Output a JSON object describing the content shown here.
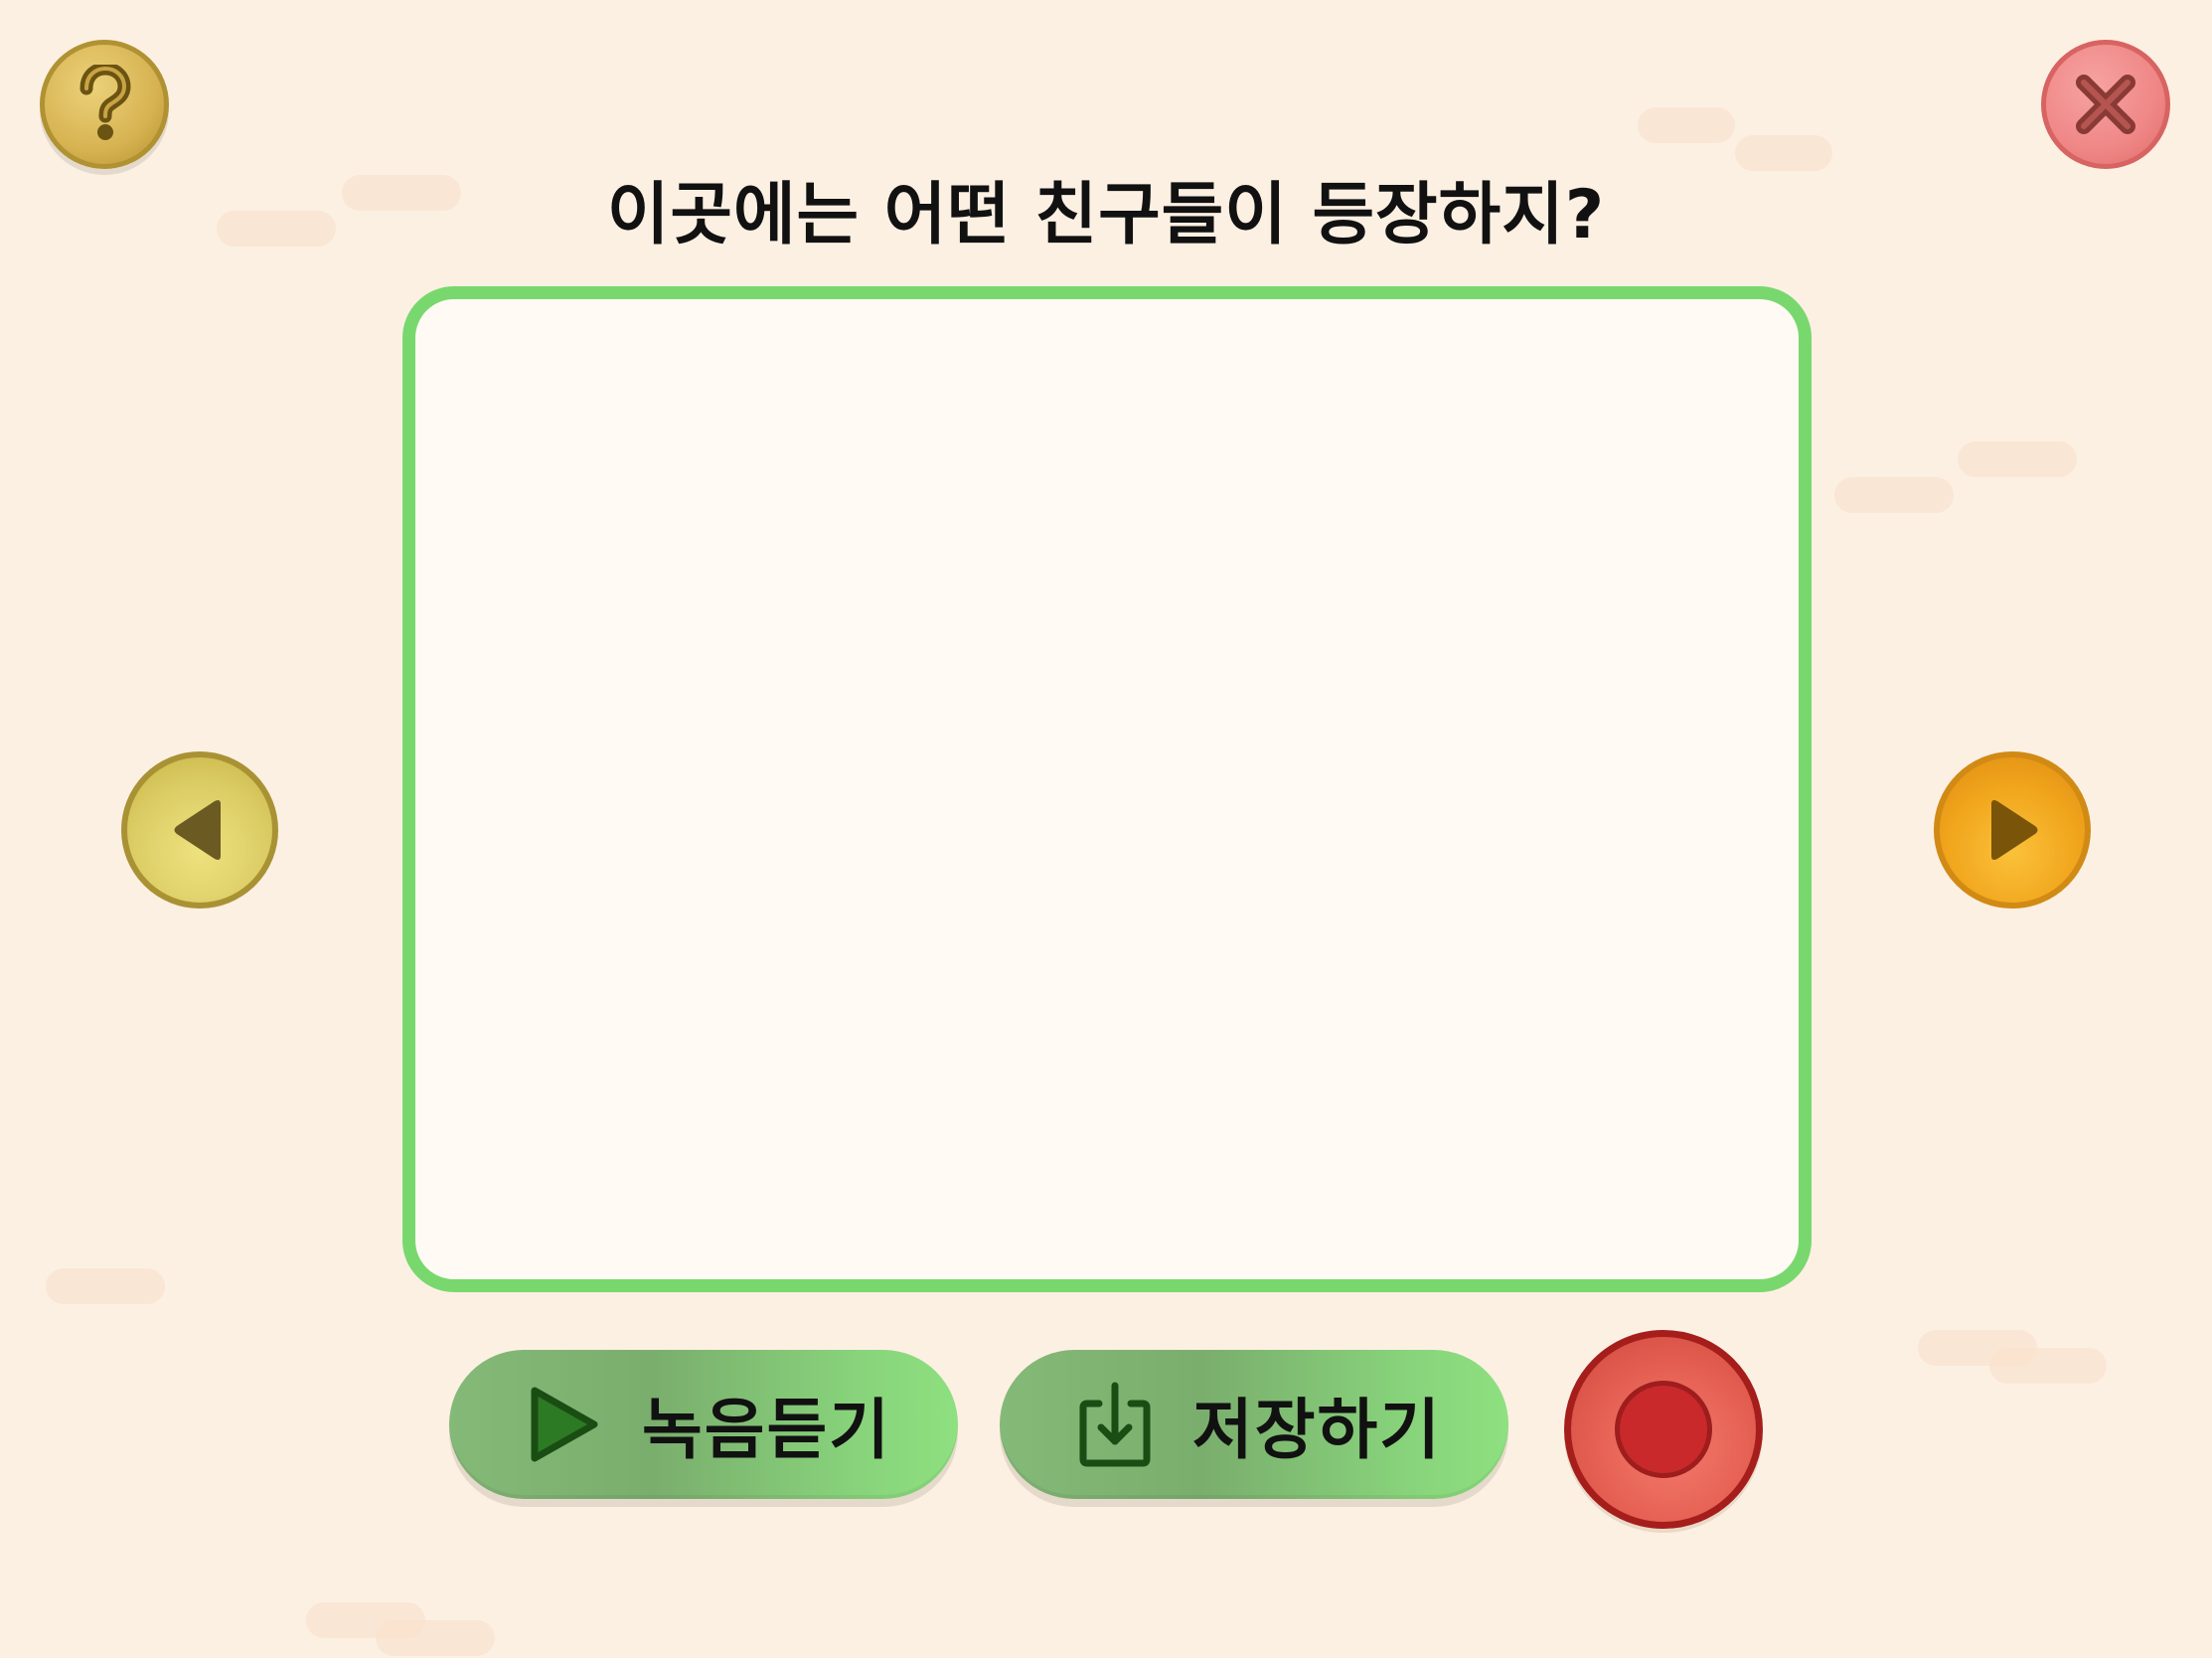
{
  "header": {
    "help_icon": "question-mark-icon",
    "close_icon": "close-x-icon"
  },
  "question": {
    "title": "이곳에는 어떤 친구들이 등장하지?"
  },
  "answer_panel": {
    "text": ""
  },
  "navigation": {
    "prev_icon": "triangle-left-icon",
    "next_icon": "triangle-right-icon"
  },
  "controls": {
    "listen_label": "녹음듣기",
    "listen_icon": "play-icon",
    "save_label": "저장하기",
    "save_icon": "download-icon",
    "record_icon": "record-icon"
  },
  "colors": {
    "background": "#fcf0e3",
    "panel_border": "#78d86e",
    "panel_fill": "#fffbf4",
    "button_green": "#88d37b",
    "record_red": "#e45f52",
    "next_orange": "#f0a51c",
    "prev_yellow": "#dccd66"
  }
}
